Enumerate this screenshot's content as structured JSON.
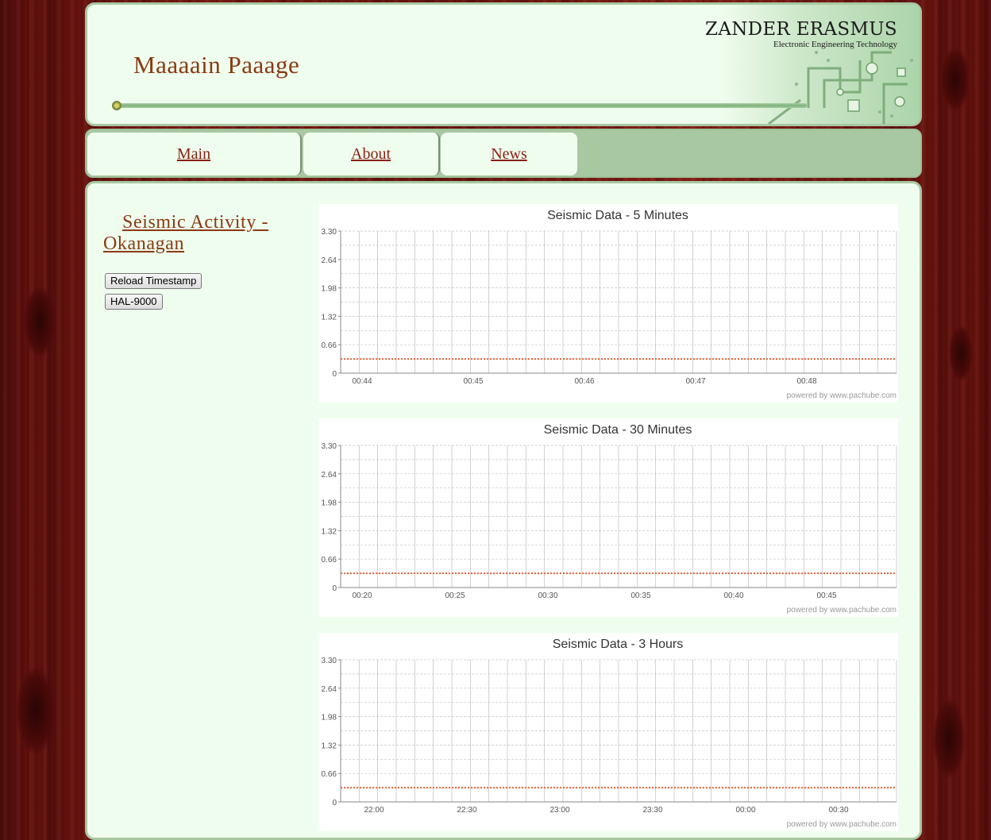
{
  "header": {
    "site_title": "Maaaain Paaage",
    "brand_name": "ZANDER ERASMUS",
    "brand_subtitle": "Electronic Engineering Technology"
  },
  "nav": {
    "tabs": [
      {
        "label": "Main"
      },
      {
        "label": "About"
      },
      {
        "label": "News"
      }
    ]
  },
  "sidebar": {
    "section_title": "Seismic Activity - Okanagan",
    "buttons": {
      "reload": "Reload Timestamp",
      "hal": "HAL-9000"
    }
  },
  "colors": {
    "accent_title": "#8a3a12",
    "link": "#8a1f12",
    "panel_bg": "#effdee",
    "nav_bg": "#a8c8a2",
    "series": "#e8643c"
  },
  "chart_data": [
    {
      "type": "line",
      "title": "Seismic Data - 5 Minutes",
      "xlabel": "",
      "ylabel": "",
      "ylim": [
        0,
        3.3
      ],
      "y_ticks": [
        "3.30",
        "2.64",
        "1.98",
        "1.32",
        "0.66",
        "0"
      ],
      "x_ticks": [
        "00:44",
        "00:45",
        "00:46",
        "00:47",
        "00:48"
      ],
      "series": [
        {
          "values": [
            0.33,
            0.33,
            0.33,
            0.33,
            0.33
          ]
        }
      ],
      "grid": true,
      "credit": "powered by www.pachube.com"
    },
    {
      "type": "line",
      "title": "Seismic Data - 30 Minutes",
      "xlabel": "",
      "ylabel": "",
      "ylim": [
        0,
        3.3
      ],
      "y_ticks": [
        "3.30",
        "2.64",
        "1.98",
        "1.32",
        "0.66",
        "0"
      ],
      "x_ticks": [
        "00:20",
        "00:25",
        "00:30",
        "00:35",
        "00:40",
        "00:45"
      ],
      "series": [
        {
          "values": [
            0.33,
            0.33,
            0.33,
            0.33,
            0.33,
            0.33
          ]
        }
      ],
      "grid": true,
      "credit": "powered by www.pachube.com"
    },
    {
      "type": "line",
      "title": "Seismic Data - 3 Hours",
      "xlabel": "",
      "ylabel": "",
      "ylim": [
        0,
        3.3
      ],
      "y_ticks": [
        "3.30",
        "2.64",
        "1.98",
        "1.32",
        "0.66",
        "0"
      ],
      "x_ticks": [
        "22:00",
        "22:30",
        "23:00",
        "23:30",
        "00:00",
        "00:30"
      ],
      "series": [
        {
          "values": [
            0.33,
            0.33,
            0.33,
            0.33,
            0.33,
            0.33
          ]
        }
      ],
      "grid": true,
      "credit": "powered by www.pachube.com"
    }
  ]
}
